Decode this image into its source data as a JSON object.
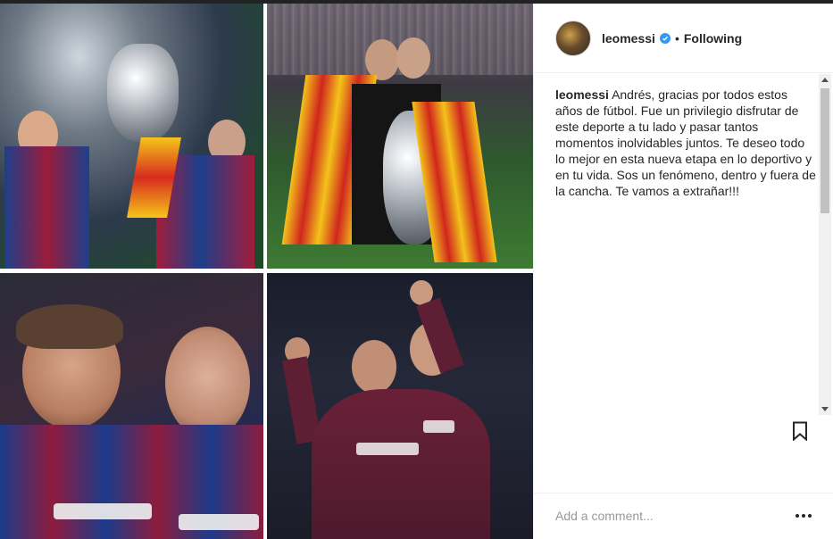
{
  "post": {
    "author": "leomessi",
    "separator": "•",
    "follow_state": "Following",
    "caption_author": "leomessi",
    "caption_text": "Andrés, gracias por todos estos años de fútbol. Fue un privilegio disfrutar de este deporte a tu lado y pasar tantos momentos inolvidables juntos. Te deseo todo lo mejor en esta nueva etapa en lo deportivo y en tu vida. Sos un fenómeno, dentro y fuera de la cancha. Te vamos a extrañar!!!",
    "comment_placeholder": "Add a comment...",
    "photos": [
      "photo-1",
      "photo-2",
      "photo-3",
      "photo-4"
    ]
  },
  "icons": {
    "verified": "verified-badge-icon",
    "bookmark": "bookmark-icon",
    "more": "more-options-icon"
  },
  "colors": {
    "verified": "#3897f0",
    "text": "#262626",
    "muted": "#999999"
  }
}
